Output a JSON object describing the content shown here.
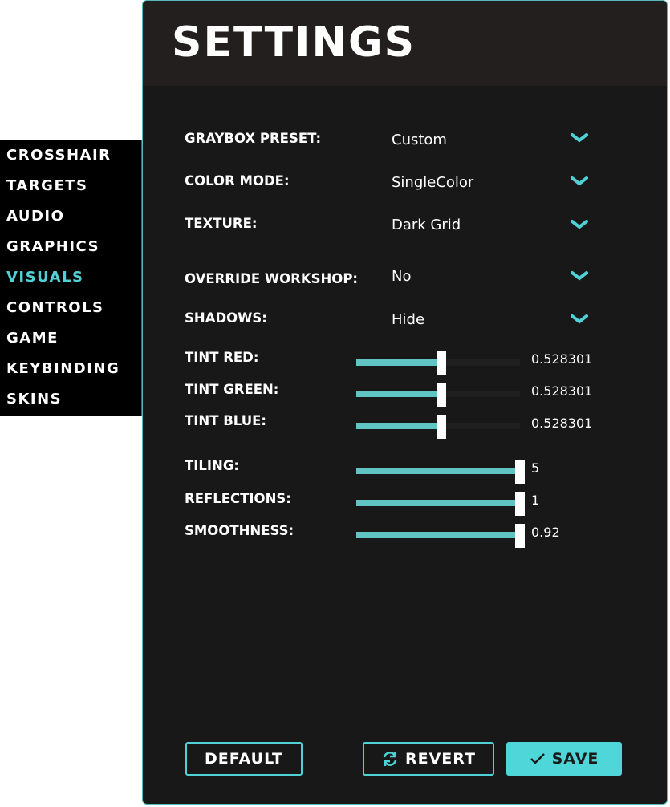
{
  "sidebar": {
    "items": [
      {
        "label": "CROSSHAIR"
      },
      {
        "label": "TARGETS"
      },
      {
        "label": "AUDIO"
      },
      {
        "label": "GRAPHICS"
      },
      {
        "label": "VISUALS",
        "active": true
      },
      {
        "label": "CONTROLS"
      },
      {
        "label": "GAME"
      },
      {
        "label": "KEYBINDING"
      },
      {
        "label": "SKINS"
      }
    ]
  },
  "header": {
    "title": "SETTINGS"
  },
  "dropdowns": [
    {
      "label": "GRAYBOX PRESET:",
      "value": "Custom",
      "icon": "chevron-down-icon"
    },
    {
      "label": "COLOR MODE:",
      "value": "SingleColor",
      "icon": "chevron-down-icon"
    },
    {
      "label": "TEXTURE:",
      "value": "Dark Grid",
      "icon": "chevron-down-icon"
    },
    {
      "label": "OVERRIDE WORKSHOP:",
      "value": "No",
      "icon": "chevron-down-icon"
    },
    {
      "label": "SHADOWS:",
      "value": "Hide",
      "icon": "chevron-down-icon"
    }
  ],
  "sliders": [
    {
      "label": "TINT RED:",
      "value": "0.528301",
      "fraction": 0.52
    },
    {
      "label": "TINT GREEN:",
      "value": "0.528301",
      "fraction": 0.52
    },
    {
      "label": "TINT BLUE:",
      "value": "0.528301",
      "fraction": 0.52
    },
    {
      "label": "TILING:",
      "value": "5",
      "fraction": 1.0
    },
    {
      "label": "REFLECTIONS:",
      "value": "1",
      "fraction": 1.0
    },
    {
      "label": "SMOOTHNESS:",
      "value": "0.92",
      "fraction": 1.0
    }
  ],
  "buttons": {
    "default_label": "DEFAULT",
    "revert_label": "REVERT",
    "save_label": "SAVE"
  },
  "colors": {
    "accent": "#4fd1d6",
    "slider_fill": "#5fc4c3",
    "panel_bg": "#181818",
    "header_bg": "#231f1f"
  }
}
